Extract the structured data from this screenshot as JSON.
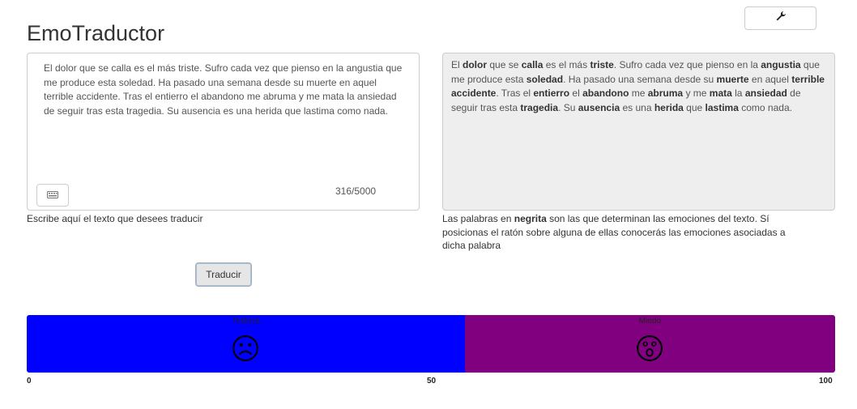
{
  "app": {
    "title": "EmoTraductor"
  },
  "toolbar": {
    "settings_icon": "wrench-icon"
  },
  "input": {
    "text": "El dolor que se calla es el más triste. Sufro cada vez que pienso en la angustia que me produce esta soledad. Ha pasado una semana desde su muerte en aquel terrible accidente. Tras el entierro el abandono me abruma y me mata la ansiedad de seguir tras esta tragedia. Su ausencia es una herida que lastima como nada.",
    "counter": "316/5000",
    "keyboard_icon": "keyboard-icon",
    "help": "Escribe aquí el texto que desees traducir"
  },
  "output": {
    "segments": [
      {
        "t": "El ",
        "b": false
      },
      {
        "t": "dolor",
        "b": true
      },
      {
        "t": " que se ",
        "b": false
      },
      {
        "t": "calla",
        "b": true
      },
      {
        "t": " es el más ",
        "b": false
      },
      {
        "t": "triste",
        "b": true
      },
      {
        "t": ". Sufro cada vez que pienso en la ",
        "b": false
      },
      {
        "t": "angustia",
        "b": true
      },
      {
        "t": " que me produce esta ",
        "b": false
      },
      {
        "t": "soledad",
        "b": true
      },
      {
        "t": ". Ha pasado una semana desde su ",
        "b": false
      },
      {
        "t": "muerte",
        "b": true
      },
      {
        "t": " en aquel ",
        "b": false
      },
      {
        "t": "terrible accidente",
        "b": true
      },
      {
        "t": ". Tras el ",
        "b": false
      },
      {
        "t": "entierro",
        "b": true
      },
      {
        "t": " el ",
        "b": false
      },
      {
        "t": "abandono",
        "b": true
      },
      {
        "t": " me ",
        "b": false
      },
      {
        "t": "abruma",
        "b": true
      },
      {
        "t": " y me ",
        "b": false
      },
      {
        "t": "mata",
        "b": true
      },
      {
        "t": " la ",
        "b": false
      },
      {
        "t": "ansiedad",
        "b": true
      },
      {
        "t": " de seguir tras esta ",
        "b": false
      },
      {
        "t": "tragedia",
        "b": true
      },
      {
        "t": ". Su ",
        "b": false
      },
      {
        "t": "ausencia",
        "b": true
      },
      {
        "t": " es una ",
        "b": false
      },
      {
        "t": "herida",
        "b": true
      },
      {
        "t": " que ",
        "b": false
      },
      {
        "t": "lastima",
        "b": true
      },
      {
        "t": " como nada.",
        "b": false
      }
    ],
    "help_before": "Las palabras en ",
    "help_bold": "negrita",
    "help_after": " son las que determinan las emociones del texto. Sí posicionas el ratón sobre alguna de ellas conocerás las emociones asociadas a dicha palabra"
  },
  "actions": {
    "translate_label": "Traducir"
  },
  "emotions": [
    {
      "name": "Tristeza",
      "percent": 54.2,
      "color": "#0000ff",
      "icon": "sad-face-icon"
    },
    {
      "name": "Miedo",
      "percent": 45.8,
      "color": "#800080",
      "icon": "fear-face-icon"
    }
  ],
  "scale": {
    "min": "0",
    "mid": "50",
    "max": "100"
  }
}
